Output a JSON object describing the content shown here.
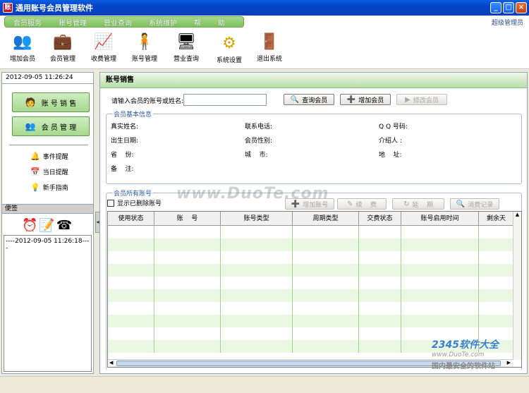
{
  "window": {
    "title": "通用账号会员管理软件",
    "buttons": {
      "min": "_",
      "max": "□",
      "close": "×"
    }
  },
  "menu": {
    "items": [
      "会员服务",
      "账号管理",
      "营业查询",
      "系统维护",
      "帮",
      "助"
    ],
    "user": "超级管理员"
  },
  "toolbar": {
    "items": [
      {
        "label": "增加会员",
        "icon": "add-member-icon"
      },
      {
        "label": "会员管理",
        "icon": "member-manage-icon"
      },
      {
        "label": "收费管理",
        "icon": "fee-chart-icon"
      },
      {
        "label": "账号管理",
        "icon": "account-manage-icon"
      },
      {
        "label": "营业查询",
        "icon": "monitor-icon"
      },
      {
        "label": "系统设置",
        "icon": "gears-icon"
      },
      {
        "label": "退出系统",
        "icon": "exit-door-icon"
      }
    ]
  },
  "left": {
    "datetime": "2012-09-05  11:26:24",
    "btn_sales": "账 号 销 售",
    "btn_member": "会 员 管 理",
    "links": [
      "事件提醒",
      "当日提醒",
      "新手指南"
    ],
    "notes_title": "便签",
    "notes_entry": "----2012-09-05 11:26:18----"
  },
  "main": {
    "header": "账号销售",
    "search_label": "请输入会员的账号或姓名:",
    "search_value": "",
    "btn_query": "查询会员",
    "btn_add": "增加会员",
    "btn_edit": "修改会员",
    "basic_title": "会员基本信息",
    "fields": {
      "name": "真实姓名:",
      "phone": "联系电话:",
      "qq": "Q Q 号码:",
      "birthday": "出生日期:",
      "gender": "会员性别:",
      "referrer": "介绍人 :",
      "province": "省    份:",
      "city": "城    市:",
      "address": "地    址:",
      "remark": "备    注:"
    },
    "accounts_title": "会员所有账号",
    "show_deleted": "显示已删除账号",
    "btn_add_account": "增加账号",
    "btn_renew": "续    费",
    "btn_extend": "延    期",
    "btn_consume": "消费记录",
    "columns": [
      "使用状态",
      "账    号",
      "账号类型",
      "周期类型",
      "交费状态",
      "账号启用时间",
      "剩余天"
    ]
  },
  "watermark": {
    "site": "www.DuoTe.com",
    "badge": "2345软件大全",
    "badge_url": "www.DuoTe.com",
    "badge_slogan": "国内最安全的软件站"
  }
}
